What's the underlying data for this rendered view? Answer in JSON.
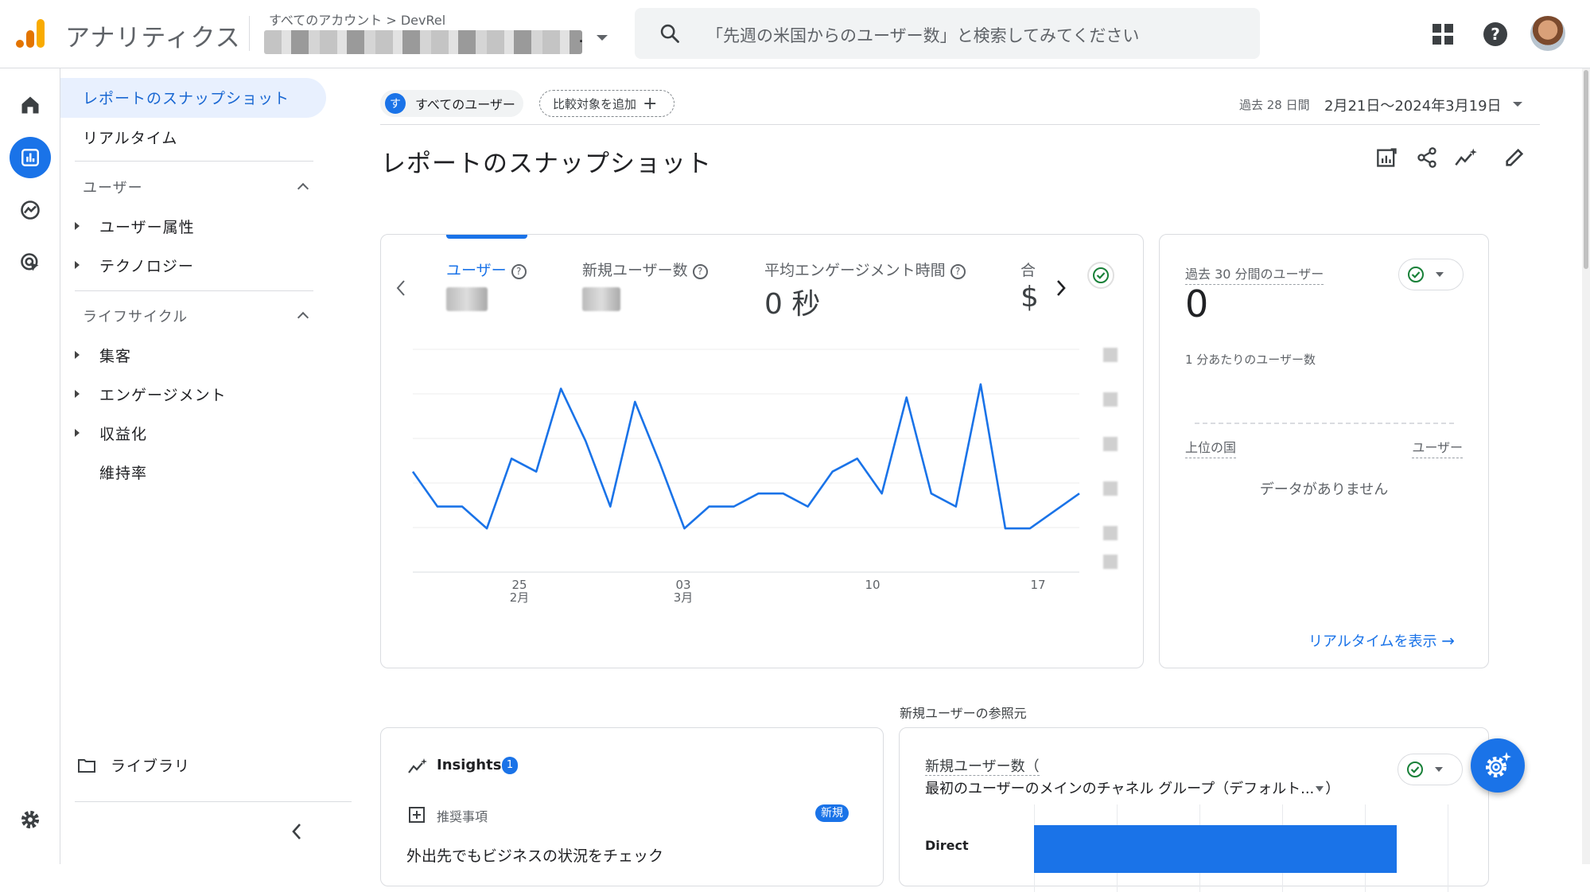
{
  "header": {
    "app_title": "アナリティクス",
    "breadcrumb": "すべてのアカウント > DevRel",
    "account_suffix": ".",
    "search_placeholder": "「先週の米国からのユーザー数」と検索してみてください"
  },
  "nav": {
    "snapshot": "レポートのスナップショット",
    "realtime": "リアルタイム",
    "users_section": "ユーザー",
    "user_attributes": "ユーザー属性",
    "technology": "テクノロジー",
    "lifecycle_section": "ライフサイクル",
    "acquisition": "集客",
    "engagement": "エンゲージメント",
    "monetization": "収益化",
    "retention": "維持率",
    "library": "ライブラリ"
  },
  "filters": {
    "segment_avatar": "す",
    "segment": "すべてのユーザー",
    "add_comparison": "比較対象を追加",
    "date_range_label": "過去 28 日間",
    "date_range_value": "2月21日〜2024年3月19日"
  },
  "page_title": "レポートのスナップショット",
  "metrics": {
    "users": "ユーザー",
    "new_users": "新規ユーザー数",
    "avg_engagement": "平均エンゲージメント時間",
    "avg_engagement_value": "0 秒",
    "total_partial": "合",
    "total_value_partial": "$"
  },
  "chart_data": {
    "type": "line",
    "x_ticks": [
      {
        "day": "25",
        "month": "2月"
      },
      {
        "day": "03",
        "month": "3月"
      },
      {
        "day": "10",
        "month": ""
      },
      {
        "day": "17",
        "month": ""
      }
    ],
    "values": [
      3.9,
      3.1,
      3.1,
      2.6,
      4.2,
      3.9,
      5.8,
      4.6,
      3.1,
      5.5,
      4.1,
      2.6,
      3.1,
      3.1,
      3.4,
      3.4,
      3.1,
      3.9,
      4.2,
      3.4,
      5.6,
      3.4,
      3.1,
      5.9,
      2.6,
      2.6,
      3.0,
      3.4
    ],
    "ylim": [
      1.6,
      6.7
    ],
    "grid": true,
    "color": "#1a73e8"
  },
  "realtime": {
    "title": "過去 30 分間のユーザー",
    "count": "0",
    "per_minute": "1 分あたりのユーザー数",
    "top_country": "上位の国",
    "users_col": "ユーザー",
    "no_data": "データがありません",
    "link": "リアルタイムを表示"
  },
  "insights": {
    "title": "Insights",
    "count": "1",
    "recommendation_label": "推奨事項",
    "new_badge": "新規",
    "text": "外出先でもビジネスの状況をチェック"
  },
  "referral": {
    "section_label": "新規ユーザーの参照元",
    "title_line1": "新規ユーザー数（",
    "title_line2": "最初のユーザーのメインのチャネル グループ（デフォルト...",
    "title_line2_end": "）",
    "bar_label": "Direct"
  }
}
